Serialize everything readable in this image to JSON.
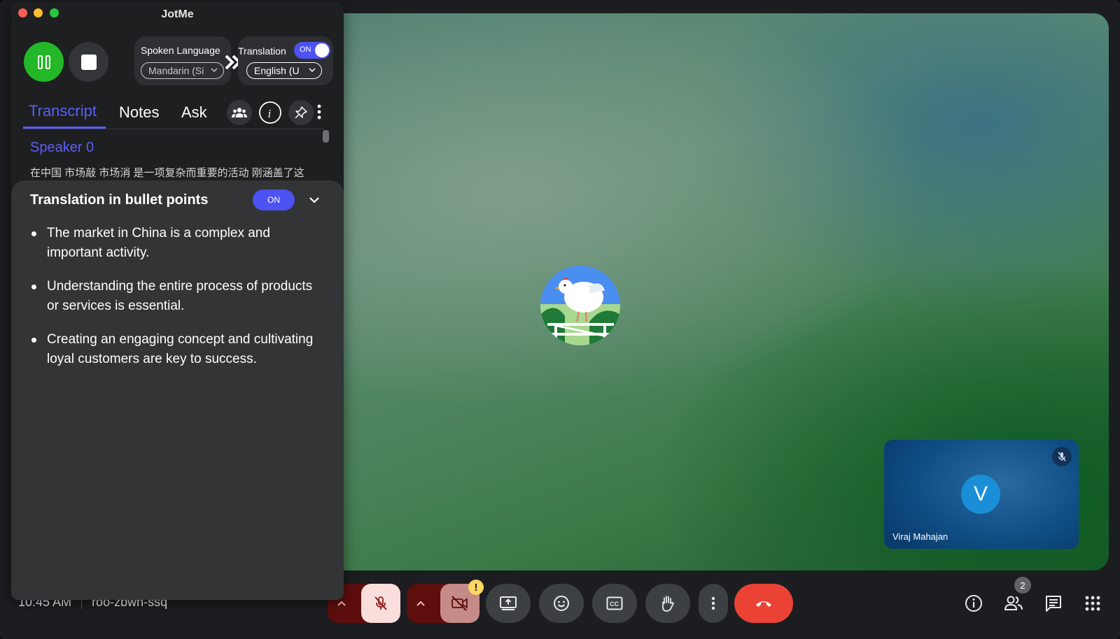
{
  "app": {
    "title": "JotMe"
  },
  "controls": {
    "spoken_language_label": "Spoken Language",
    "spoken_language_value": "Mandarin (Si",
    "translation_label": "Translation",
    "translation_toggle": "ON",
    "target_language_value": "English (U"
  },
  "tabs": [
    {
      "label": "Transcript",
      "active": true
    },
    {
      "label": "Notes",
      "active": false
    },
    {
      "label": "Ask",
      "active": false
    }
  ],
  "transcript": {
    "speaker": "Speaker 0",
    "text": "在中国 市场敲 市场消 是一项复杂而重要的活动 刚涵盖了这"
  },
  "translation_panel": {
    "title": "Translation in bullet points",
    "toggle": "ON",
    "bullets": [
      "The market in China is a complex and important activity.",
      "Understanding the entire process of products or services is essential.",
      "Creating an engaging concept and cultivating loyal customers are key to success."
    ]
  },
  "meeting": {
    "time": "10:45 AM",
    "code": "roo-zbwn-ssq",
    "participant_count": "2",
    "self_name": "Viraj Mahajan",
    "self_initial": "V",
    "camera_warning": "!"
  },
  "colors": {
    "accent": "#4d52f2",
    "record_green": "#22b827",
    "end_call_red": "#ea4335"
  }
}
